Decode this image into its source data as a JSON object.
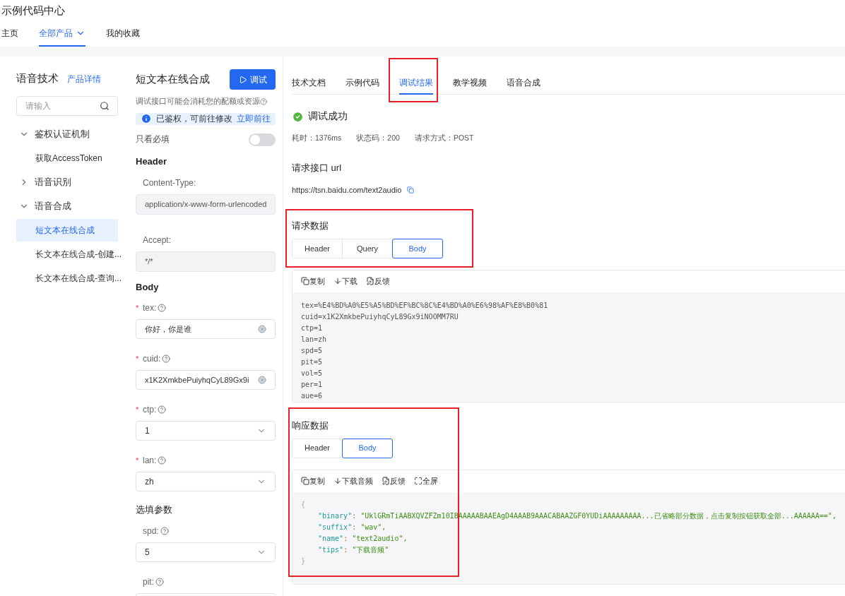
{
  "app_title": "示例代码中心",
  "nav": [
    {
      "label": "主页",
      "selected": false,
      "dropdown": false
    },
    {
      "label": "全部产品",
      "selected": true,
      "dropdown": true
    },
    {
      "label": "我的收藏",
      "selected": false,
      "dropdown": false
    }
  ],
  "sidebar": {
    "title": "语音技术",
    "link": "产品详情",
    "search": {
      "placeholder": "请输入"
    },
    "items": [
      {
        "label": "鉴权认证机制",
        "expanded": true,
        "selected": false,
        "children": [
          {
            "label": "获取AccessToken",
            "selected": false
          }
        ]
      },
      {
        "label": "语音识别",
        "expanded": false,
        "selected": false
      },
      {
        "label": "语音合成",
        "expanded": true,
        "selected": false,
        "children": [
          {
            "label": "短文本在线合成",
            "selected": true
          },
          {
            "label": "长文本在线合成-创建...",
            "selected": false
          },
          {
            "label": "长文本在线合成-查询...",
            "selected": false
          }
        ]
      }
    ]
  },
  "form": {
    "title": "短文本在线合成",
    "debug_button": "调试",
    "note": "调试接口可能会消耗您的配额或资源",
    "notice": {
      "text": "已鉴权，可前往修改",
      "link": "立即前往"
    },
    "required_only": {
      "label": "只看必填",
      "on": false
    },
    "sections": [
      {
        "title": "Header",
        "fields": [
          {
            "label": "Content-Type:",
            "kind": "readonly",
            "help": false,
            "value": "application/x-www-form-urlencoded"
          },
          {
            "label": "Accept:",
            "kind": "readonly",
            "help": false,
            "value": "*/*"
          }
        ]
      },
      {
        "title": "Body",
        "fields": [
          {
            "label": "tex:",
            "kind": "input",
            "required_mark": "*",
            "help": true,
            "value": "你好，你是谁"
          },
          {
            "label": "cuid:",
            "kind": "input",
            "required_mark": "*",
            "help": true,
            "value": "x1K2XmkbePuiyhqCyL89Gx9i"
          },
          {
            "label": "ctp:",
            "kind": "select",
            "required_mark": "*",
            "help": true,
            "value": "1"
          },
          {
            "label": "lan:",
            "kind": "select",
            "required_mark": "*",
            "help": true,
            "value": "zh"
          }
        ]
      },
      {
        "title": "选填参数",
        "fields": [
          {
            "label": "spd:",
            "kind": "select",
            "help": true,
            "value": "5"
          },
          {
            "label": "pit:",
            "kind": "select",
            "help": true
          }
        ]
      }
    ]
  },
  "tabs": [
    {
      "label": "技术文档",
      "selected": false,
      "highlighted": false
    },
    {
      "label": "示例代码",
      "selected": false,
      "highlighted": false
    },
    {
      "label": "调试结果",
      "selected": true,
      "highlighted": true
    },
    {
      "label": "教学视频",
      "selected": false,
      "highlighted": false
    },
    {
      "label": "语音合成",
      "selected": false,
      "highlighted": false
    }
  ],
  "result": {
    "status": "调试成功",
    "success": true,
    "meta": [
      "耗时：1376ms",
      "状态码：200",
      "请求方式：POST"
    ]
  },
  "url_section": {
    "title": "请求接口 url",
    "url": "https://tsn.baidu.com/text2audio"
  },
  "request_data": {
    "title": "请求数据",
    "highlighted": true,
    "tabs": [
      {
        "label": "Header",
        "selected": false
      },
      {
        "label": "Query",
        "selected": false
      },
      {
        "label": "Body",
        "selected": true
      }
    ],
    "toolbar": [
      {
        "kind": "copy",
        "label": "复制"
      },
      {
        "kind": "download",
        "label": "下载"
      },
      {
        "kind": "feedback",
        "label": "反馈"
      }
    ],
    "lines": [
      {
        "kind": "plain",
        "text": "tex=%E4%BD%A0%E5%A5%BD%EF%BC%8C%E4%BD%A0%E6%98%AF%E8%B0%81"
      },
      {
        "kind": "plain",
        "text": "cuid=x1K2XmkbePuiyhqCyL89Gx9iNOOMM7RU"
      },
      {
        "kind": "plain",
        "text": "ctp=1"
      },
      {
        "kind": "plain",
        "text": "lan=zh"
      },
      {
        "kind": "plain",
        "text": "spd=5"
      },
      {
        "kind": "plain",
        "text": "pit=5"
      },
      {
        "kind": "plain",
        "text": "vol=5"
      },
      {
        "kind": "plain",
        "text": "per=1"
      },
      {
        "kind": "plain",
        "text": "aue=6"
      }
    ]
  },
  "response_data": {
    "title": "响应数据",
    "highlighted": true,
    "tabs": [
      {
        "label": "Header",
        "selected": false
      },
      {
        "label": "Body",
        "selected": true
      }
    ],
    "toolbar": [
      {
        "kind": "copy",
        "label": "复制"
      },
      {
        "kind": "download",
        "label": "下载音频"
      },
      {
        "kind": "feedback",
        "label": "反馈"
      },
      {
        "kind": "fullscreen",
        "label": "全屏"
      }
    ],
    "lines": [
      {
        "kind": "brace",
        "text": "{"
      },
      {
        "kind": "pair",
        "key": "\"binary\"",
        "sep": ": ",
        "value": "\"UklGRmTiAABXQVZFZm10IBAAAAABAAEAgD4AAAB9AAACABAAZGF0YUDiAAAAAAAAA...已省略部分数据，点击复制按钮获取全部...AAAAAA==\","
      },
      {
        "kind": "pair",
        "key": "\"suffix\"",
        "sep": ": ",
        "value": "\"wav\","
      },
      {
        "kind": "pair",
        "key": "\"name\"",
        "sep": ": ",
        "value": "\"text2audio\","
      },
      {
        "kind": "pair",
        "key": "\"tips\"",
        "sep": ": ",
        "value": "\"下载音频\""
      },
      {
        "kind": "brace",
        "text": "}"
      }
    ]
  }
}
